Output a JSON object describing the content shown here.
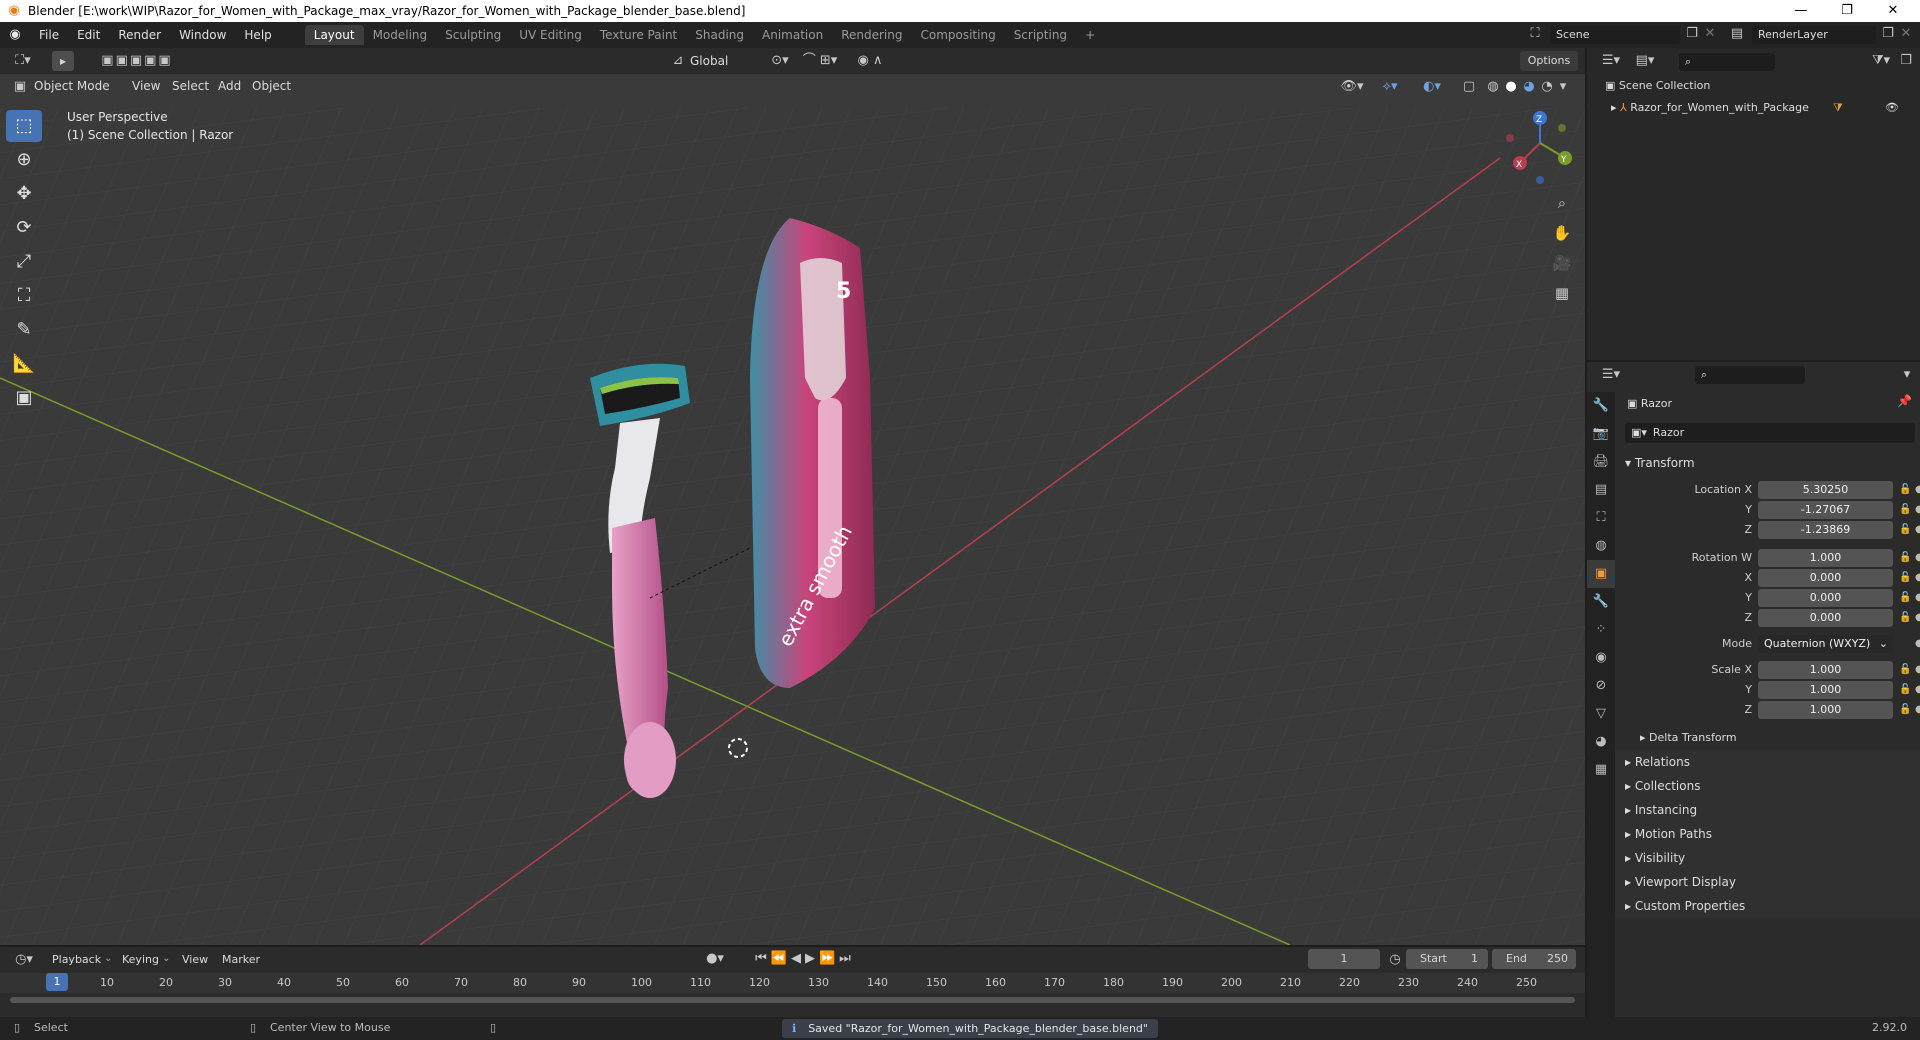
{
  "window": {
    "title": "Blender [E:\\work\\WIP\\Razor_for_Women_with_Package_max_vray/Razor_for_Women_with_Package_blender_base.blend]",
    "controls": [
      "—",
      "❐",
      "✕"
    ]
  },
  "menubar": {
    "items": [
      "File",
      "Edit",
      "Render",
      "Window",
      "Help"
    ],
    "workspaces": [
      "Layout",
      "Modeling",
      "Sculpting",
      "UV Editing",
      "Texture Paint",
      "Shading",
      "Animation",
      "Rendering",
      "Compositing",
      "Scripting"
    ],
    "active_workspace": "Layout",
    "add_workspace": "+",
    "scene_name": "Scene",
    "view_layer": "RenderLayer"
  },
  "viewport_header": {
    "mode": "Object Mode",
    "menus": [
      "View",
      "Select",
      "Add",
      "Object"
    ],
    "orientation": "Global",
    "options_label": "Options"
  },
  "viewport": {
    "perspective_label": "User Perspective",
    "collection_label": "(1) Scene Collection | Razor",
    "gizmo_axes": {
      "z": "Z",
      "y": "Y",
      "x": "X"
    },
    "colors": {
      "x_axis": "#b5404f",
      "y_axis": "#7a9c2a",
      "z_axis": "#3b78d6",
      "accent": "#4772b3",
      "package_pink": "#c9457b",
      "package_teal": "#3f8fa6"
    },
    "package_text": "extra smooth",
    "package_number": "5"
  },
  "toolbar": {
    "tools": [
      "select-box",
      "cursor",
      "move",
      "rotate",
      "scale",
      "transform",
      "annotate",
      "measure",
      "add-cube"
    ]
  },
  "outliner": {
    "root": "Scene Collection",
    "items": [
      {
        "name": "Razor_for_Women_with_Package"
      }
    ]
  },
  "properties": {
    "object_name": "Razor",
    "object_field": "Razor",
    "transform_title": "Transform",
    "location": {
      "label": "Location X",
      "x": "5.30250",
      "y": "-1.27067",
      "z": "-1.23869"
    },
    "rotation": {
      "label": "Rotation W",
      "w": "1.000",
      "x": "0.000",
      "y": "0.000",
      "z": "0.000"
    },
    "mode": {
      "label": "Mode",
      "value": "Quaternion (WXYZ)"
    },
    "scale": {
      "label": "Scale X",
      "x": "1.000",
      "y": "1.000",
      "z": "1.000"
    },
    "axis_labels": {
      "y": "Y",
      "z": "Z",
      "x": "X"
    },
    "delta": "Delta Transform",
    "panels": [
      "Relations",
      "Collections",
      "Instancing",
      "Motion Paths",
      "Visibility",
      "Viewport Display",
      "Custom Properties"
    ]
  },
  "timeline": {
    "menus": [
      "Playback",
      "Keying",
      "View",
      "Marker"
    ],
    "current_frame": "1",
    "start_label": "Start",
    "start": "1",
    "end_label": "End",
    "end": "250",
    "ruler": [
      "10",
      "20",
      "30",
      "40",
      "50",
      "60",
      "70",
      "80",
      "90",
      "100",
      "110",
      "120",
      "130",
      "140",
      "150",
      "160",
      "170",
      "180",
      "190",
      "200",
      "210",
      "220",
      "230",
      "240",
      "250"
    ],
    "ruler_current": "1"
  },
  "statusbar": {
    "select": "Select",
    "center_view": "Center View to Mouse",
    "message": "Saved \"Razor_for_Women_with_Package_blender_base.blend\"",
    "version": "2.92.0"
  }
}
